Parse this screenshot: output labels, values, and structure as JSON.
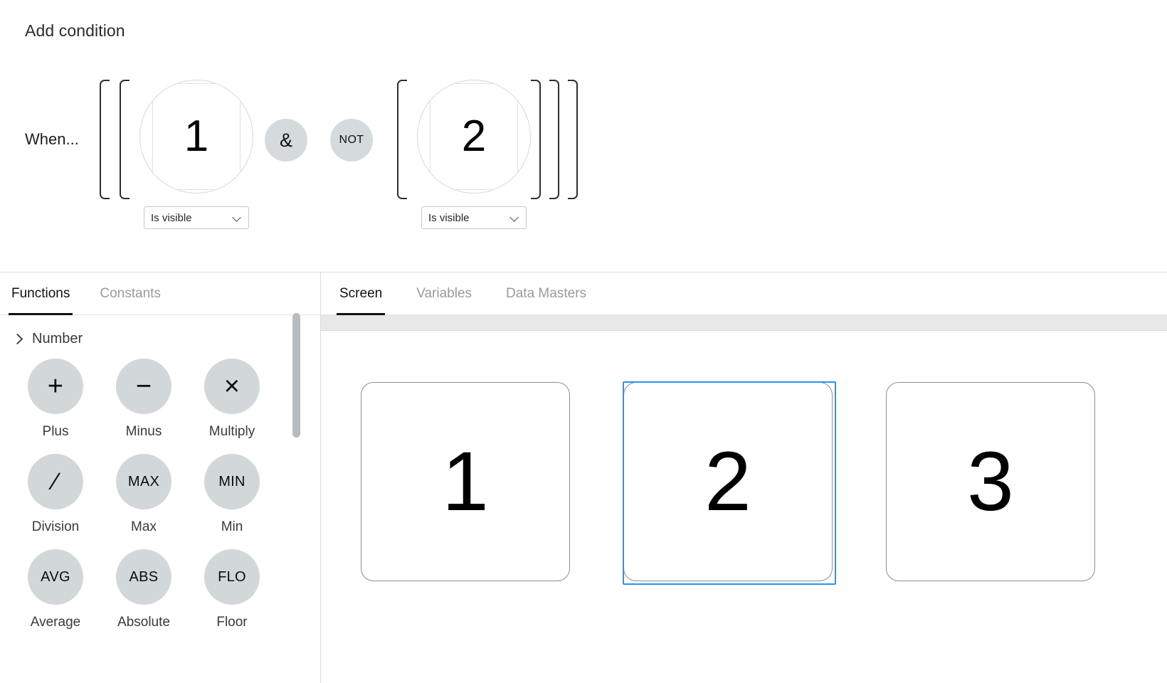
{
  "condition": {
    "title": "Add condition",
    "when_label": "When...",
    "brackets": {
      "open": "[",
      "close": "]"
    },
    "operands": [
      {
        "id": "operand-1",
        "thumb_label": "1",
        "select_value": "Is visible",
        "caret_icon": "chevron-down-icon"
      },
      {
        "id": "operand-2",
        "thumb_label": "2",
        "select_value": "Is visible",
        "caret_icon": "chevron-down-icon"
      }
    ],
    "operators": [
      {
        "id": "operator-and",
        "label": "&"
      },
      {
        "id": "operator-not",
        "label": "NOT"
      }
    ]
  },
  "left_panel": {
    "tabs": [
      {
        "label": "Functions",
        "active": true
      },
      {
        "label": "Constants",
        "active": false
      }
    ],
    "group": {
      "label": "Number",
      "expand_icon": "chevron-right-icon",
      "expanded": false
    },
    "functions": [
      {
        "glyph": "+",
        "label": "Plus",
        "icon_name": "plus-icon"
      },
      {
        "glyph": "−",
        "label": "Minus",
        "icon_name": "minus-icon"
      },
      {
        "glyph": "×",
        "label": "Multiply",
        "icon_name": "multiply-icon"
      },
      {
        "glyph": "∕",
        "label": "Division",
        "icon_name": "division-icon"
      },
      {
        "glyph": "MAX",
        "label": "Max",
        "icon_name": "max-icon"
      },
      {
        "glyph": "MIN",
        "label": "Min",
        "icon_name": "min-icon"
      },
      {
        "glyph": "AVG",
        "label": "Average",
        "icon_name": "average-icon"
      },
      {
        "glyph": "ABS",
        "label": "Absolute",
        "icon_name": "absolute-icon"
      },
      {
        "glyph": "FLO",
        "label": "Floor",
        "icon_name": "floor-icon"
      }
    ]
  },
  "right_panel": {
    "tabs": [
      {
        "label": "Screen",
        "active": true
      },
      {
        "label": "Variables",
        "active": false
      },
      {
        "label": "Data Masters",
        "active": false
      }
    ],
    "canvas": {
      "cards": [
        {
          "label": "1",
          "selected": false
        },
        {
          "label": "2",
          "selected": true
        },
        {
          "label": "3",
          "selected": false
        }
      ]
    }
  },
  "colors": {
    "selection_blue": "#2196f3",
    "icon_gray": "#d2d7da",
    "operator_gray": "#d5dadd",
    "toolstrip_gray": "#e8e8e8",
    "scrollbar_gray": "#b7bcbf"
  }
}
